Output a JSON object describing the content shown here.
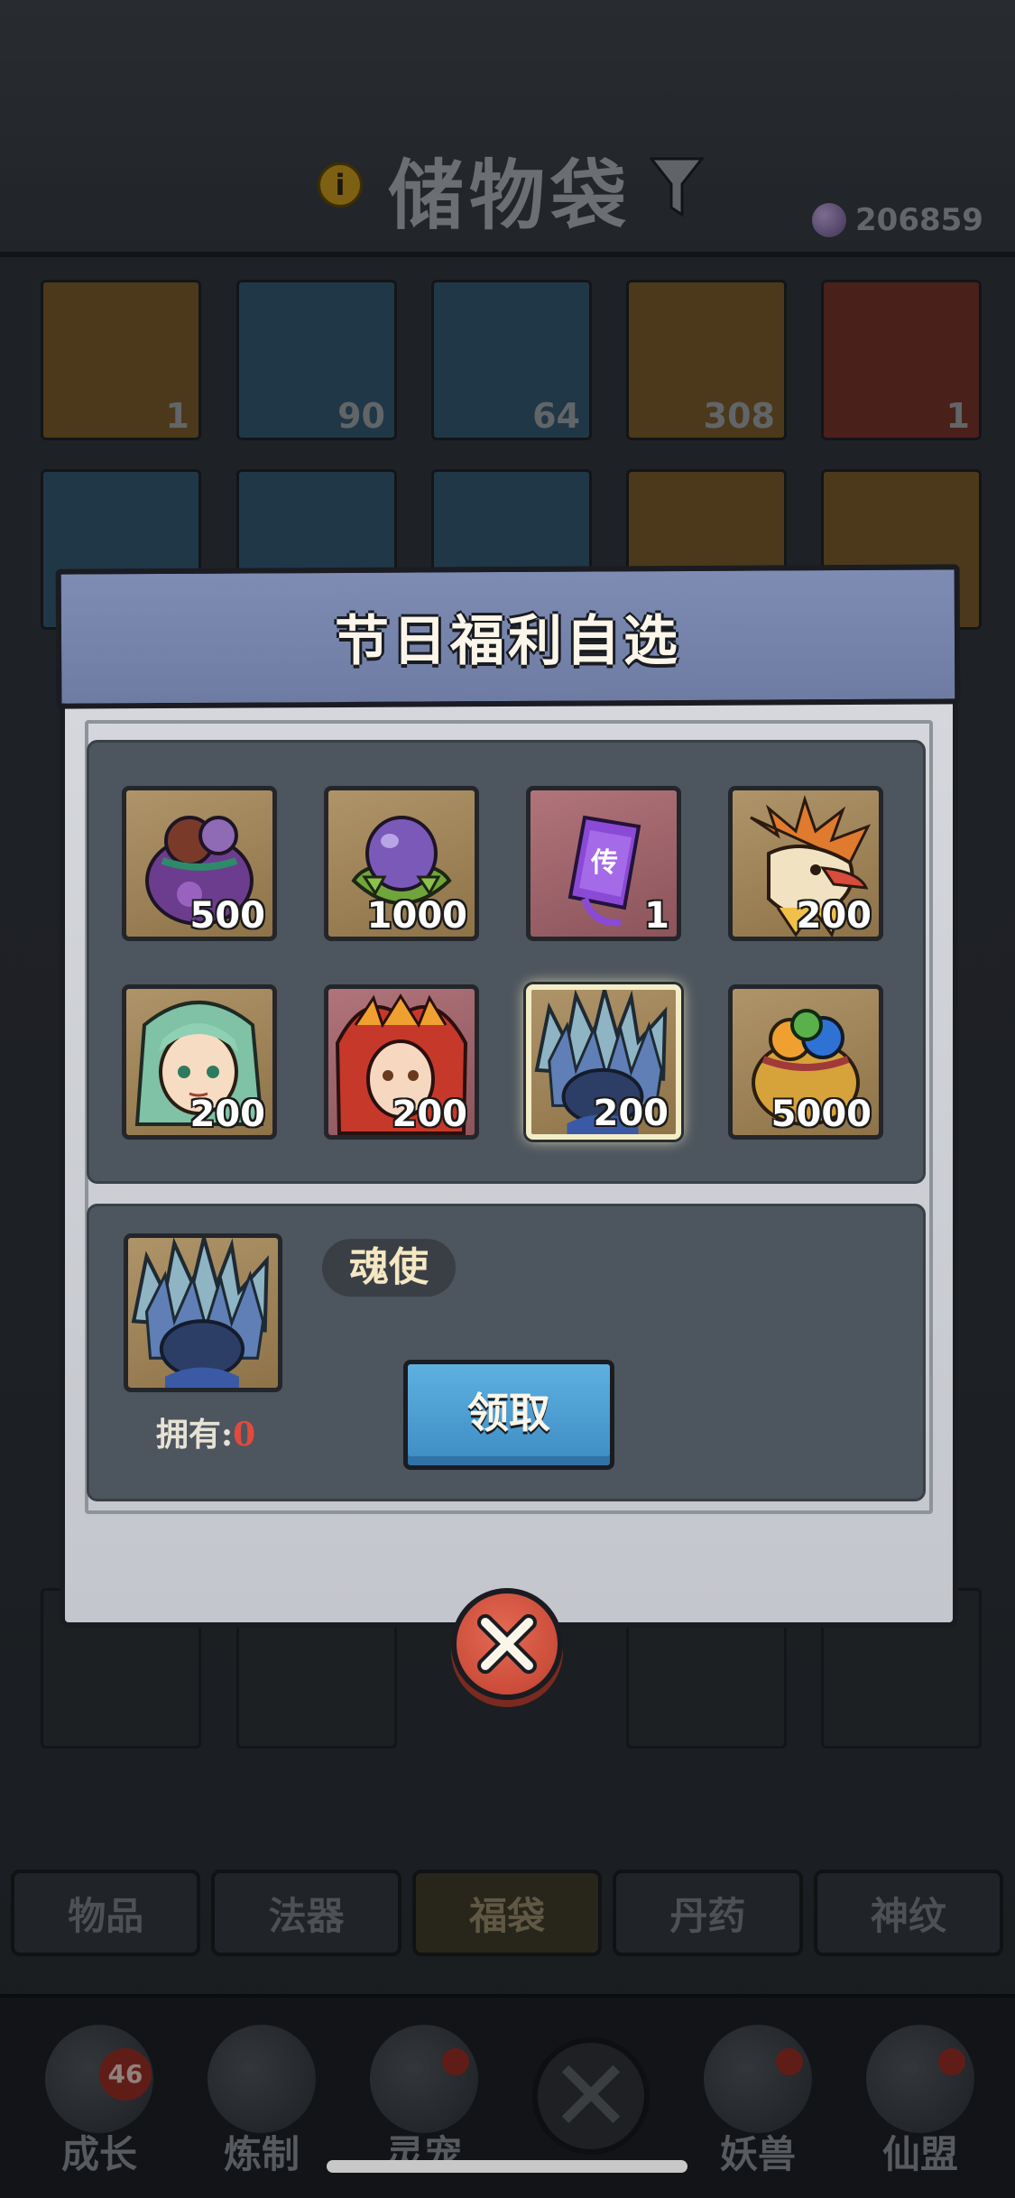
{
  "header": {
    "title": "储物袋",
    "currency_value": "206859"
  },
  "background_slots": [
    {
      "count": "1",
      "color": "#7a5a2a"
    },
    {
      "count": "90",
      "color": "#355a72"
    },
    {
      "count": "64",
      "color": "#355a72"
    },
    {
      "count": "308",
      "color": "#7a5a2a"
    },
    {
      "count": "1",
      "color": "#74332a"
    }
  ],
  "category_tabs": [
    "物品",
    "法器",
    "福袋",
    "丹药",
    "神纹"
  ],
  "active_tab": "福袋",
  "bottom_nav": [
    {
      "label": "成长",
      "badge": "46"
    },
    {
      "label": "炼制"
    },
    {
      "label": "灵宠"
    },
    {
      "label": "妖兽"
    },
    {
      "label": "仙盟"
    }
  ],
  "modal": {
    "title": "节日福利自选",
    "items": [
      {
        "name": "purple-treasure-bag",
        "count": "500",
        "frame": "tan"
      },
      {
        "name": "spirit-egg",
        "count": "1000",
        "frame": "tan"
      },
      {
        "name": "purple-token",
        "count": "1",
        "frame": "red"
      },
      {
        "name": "dragon-beast",
        "count": "200",
        "frame": "tan"
      },
      {
        "name": "green-haired-hero",
        "count": "200",
        "frame": "tan"
      },
      {
        "name": "flame-goddess",
        "count": "200",
        "frame": "red"
      },
      {
        "name": "soul-envoy",
        "count": "200",
        "frame": "tan",
        "selected": true
      },
      {
        "name": "gold-orb-bag",
        "count": "5000",
        "frame": "tan"
      }
    ],
    "detail": {
      "name": "魂使",
      "owned_label": "拥有:",
      "owned_value": "0",
      "claim_label": "领取"
    }
  }
}
